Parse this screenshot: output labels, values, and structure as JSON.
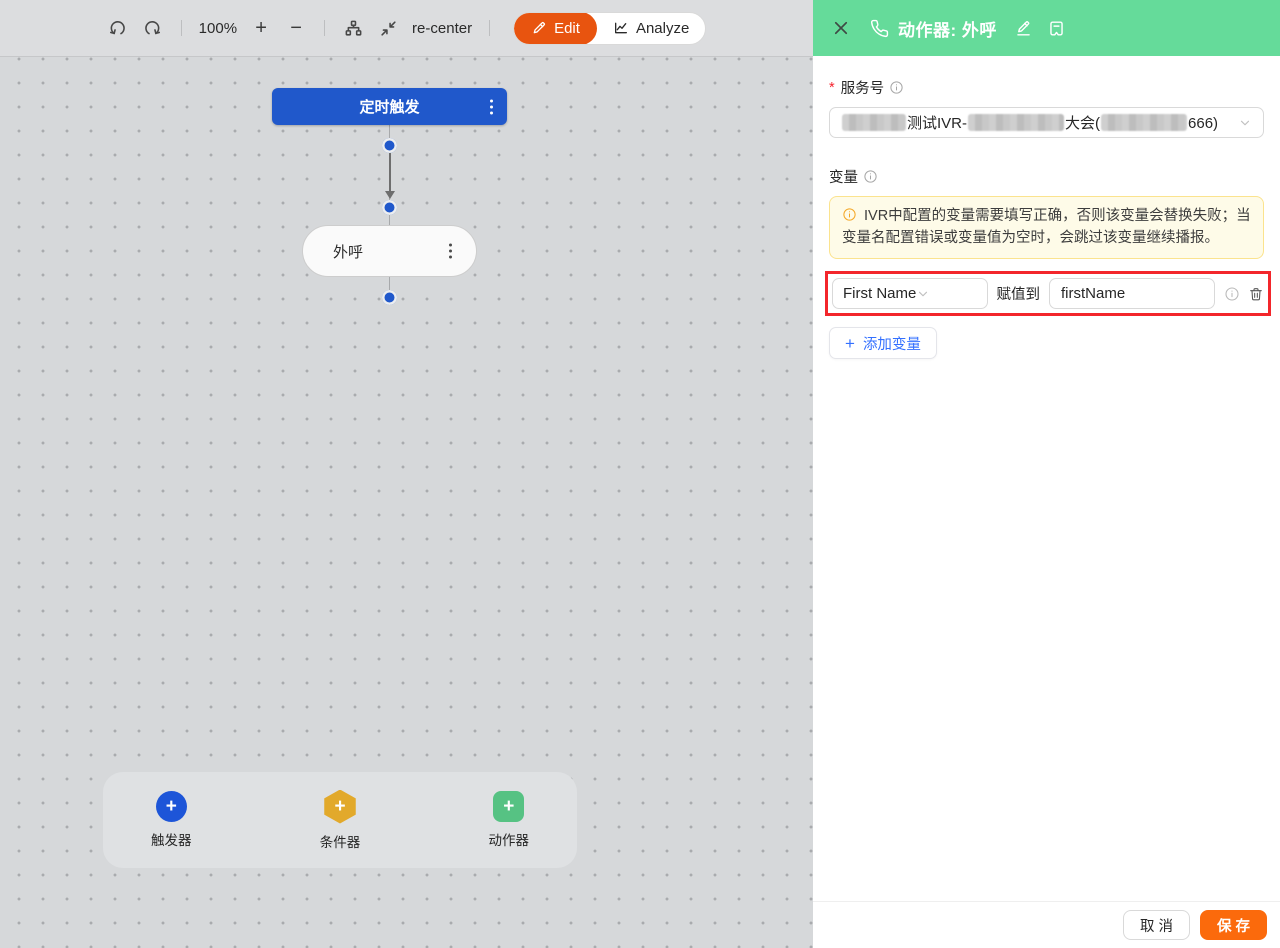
{
  "toolbar": {
    "zoom_level": "100%",
    "plus": "+",
    "minus": "−",
    "recenter_label": "re-center",
    "edit_label": "Edit",
    "analyze_label": "Analyze"
  },
  "flow": {
    "trigger_node_label": "定时触发",
    "action_node_label": "外呼"
  },
  "palette": {
    "plus": "+",
    "trigger_label": "触发器",
    "condition_label": "条件器",
    "action_label": "动作器"
  },
  "panel": {
    "title": "动作器: 外呼",
    "service": {
      "required_mark": "*",
      "label": "服务号",
      "value_part_1": "测试IVR-",
      "value_part_2": "大会(",
      "value_part_3": "666)"
    },
    "variables": {
      "label": "变量",
      "alert_text": "IVR中配置的变量需要填写正确，否则该变量会替换失败；当变量名配置错误或变量值为空时，会跳过该变量继续播报。",
      "row": {
        "variable": "First Name",
        "assign_label": "赋值到",
        "value": "firstName"
      },
      "add_plus": "+",
      "add_label": "添加变量"
    },
    "footer": {
      "cancel_label": "取 消",
      "save_label": "保 存"
    }
  },
  "colors": {
    "header_green": "#65DB9A",
    "node_blue": "#2058CB",
    "edit_orange": "#E8540F",
    "save_orange": "#FB6A0C",
    "condition_amber": "#E2A92B",
    "action_green": "#56C283",
    "annotation_red": "#F3262B",
    "link_blue": "#3370FF"
  }
}
